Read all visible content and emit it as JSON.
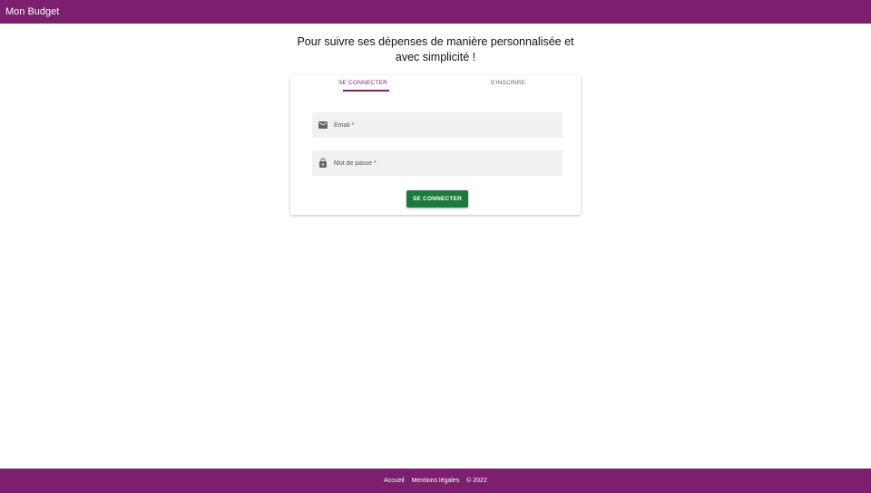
{
  "app": {
    "title": "Mon Budget"
  },
  "tagline": {
    "line1": "Pour suivre ses dépenses de manière personnalisée et",
    "line2": "avec simplicité !"
  },
  "tabs": [
    {
      "label": "SE CONNECTER",
      "active": true
    },
    {
      "label": "S'INSCRIRE",
      "active": false
    }
  ],
  "form": {
    "email_placeholder": "Email *",
    "email_value": "",
    "email_icon": "mail-icon",
    "password_placeholder": "Mot de passe *",
    "password_value": "",
    "password_icon": "lock-icon",
    "submit_label": "SE CONNECTER"
  },
  "footer": {
    "home_link": "Accueil",
    "legal_link": "Mentions légales",
    "copyright": "© 2022"
  },
  "colors": {
    "brand": "#7b1f6e",
    "submit": "#1c7a3c",
    "field_bg": "#f1f1f1"
  }
}
